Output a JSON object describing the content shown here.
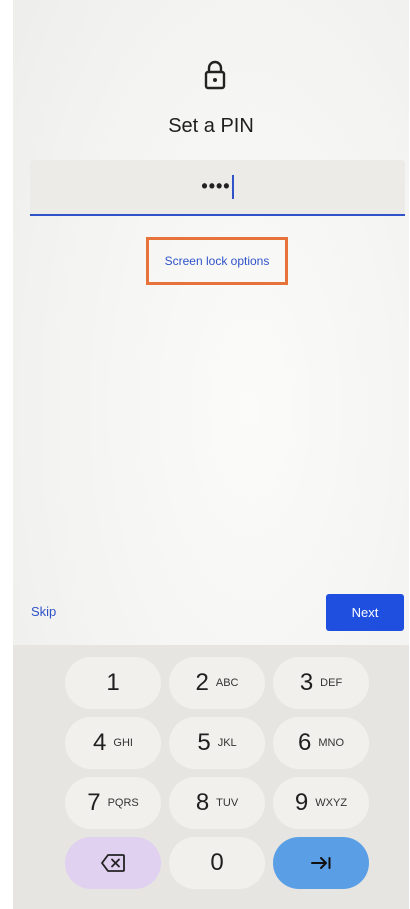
{
  "header": {
    "title": "Set a PIN",
    "lock_icon": "lock-icon"
  },
  "pin": {
    "masked_value": "••••"
  },
  "links": {
    "screen_lock_options": "Screen lock options"
  },
  "actions": {
    "skip": "Skip",
    "next": "Next"
  },
  "keypad": {
    "keys": [
      {
        "digit": "1",
        "letters": ""
      },
      {
        "digit": "2",
        "letters": "ABC"
      },
      {
        "digit": "3",
        "letters": "DEF"
      },
      {
        "digit": "4",
        "letters": "GHI"
      },
      {
        "digit": "5",
        "letters": "JKL"
      },
      {
        "digit": "6",
        "letters": "MNO"
      },
      {
        "digit": "7",
        "letters": "PQRS"
      },
      {
        "digit": "8",
        "letters": "TUV"
      },
      {
        "digit": "9",
        "letters": "WXYZ"
      },
      {
        "digit": "0",
        "letters": ""
      }
    ],
    "backspace_icon": "backspace-icon",
    "enter_icon": "tab-arrow-icon"
  },
  "colors": {
    "accent": "#2f52c9",
    "next_button": "#1e4fdf",
    "highlight_box": "#e8733a",
    "backspace_key": "#e0d1f1",
    "enter_key": "#5a9fe6"
  }
}
